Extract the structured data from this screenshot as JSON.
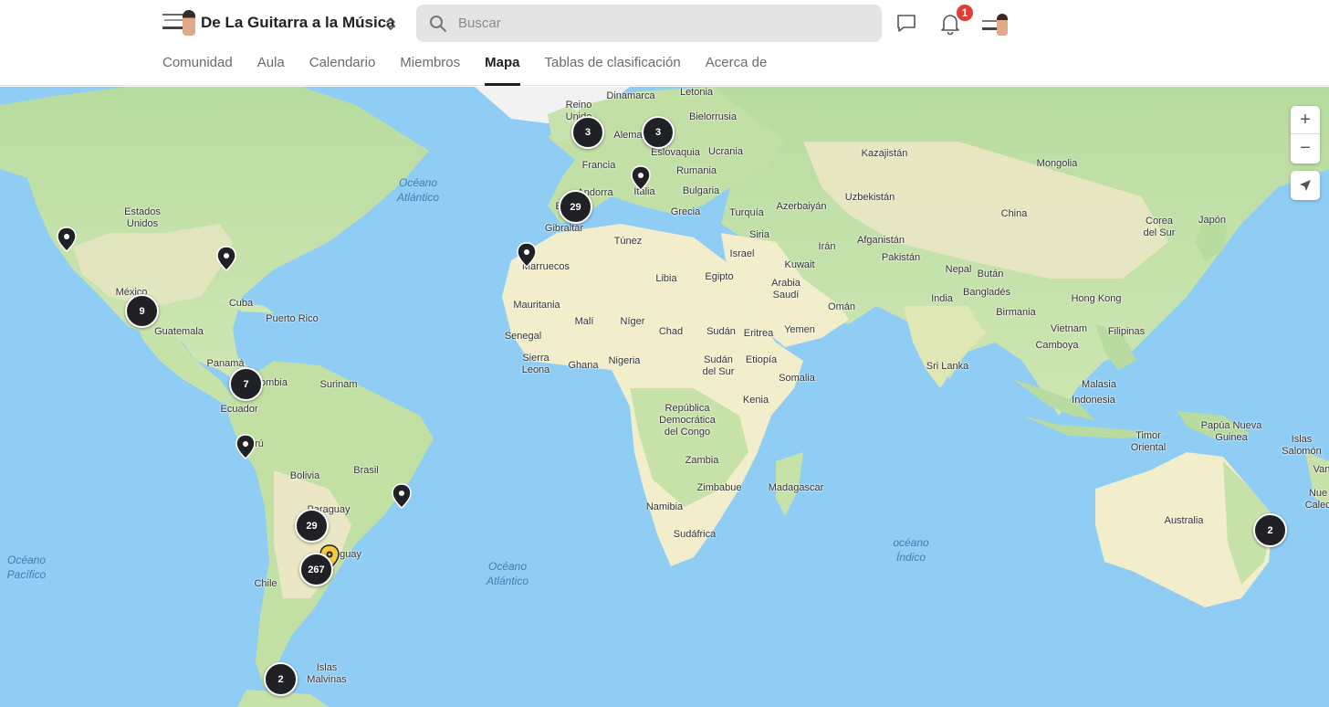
{
  "header": {
    "group_name": "De La Guitarra a la Música",
    "search_placeholder": "Buscar",
    "notification_count": "1",
    "icons": [
      "group-logo",
      "switcher-chevrons-icon",
      "search-icon",
      "chat-icon",
      "bell-icon",
      "user-avatar"
    ]
  },
  "nav": {
    "tabs": [
      {
        "label": "Comunidad",
        "active": false
      },
      {
        "label": "Aula",
        "active": false
      },
      {
        "label": "Calendario",
        "active": false
      },
      {
        "label": "Miembros",
        "active": false
      },
      {
        "label": "Mapa",
        "active": true
      },
      {
        "label": "Tablas de clasificación",
        "active": false
      },
      {
        "label": "Acerca de",
        "active": false
      }
    ]
  },
  "map": {
    "zoom_in_label": "+",
    "zoom_out_label": "−",
    "oceans": {
      "atlantico_norte": "Océano\nAtlántico",
      "atlantico_sur": "Océano\nAtlántico",
      "pacifico": "Océano\nPacífico",
      "indico": "océano\nÍndico"
    },
    "countries": {
      "estados_unidos": "Estados\nUnidos",
      "mexico": "México",
      "cuba": "Cuba",
      "puerto_rico": "Puerto Rico",
      "guatemala": "Guatemala",
      "panama": "Panamá",
      "colombia": "ombia",
      "surinam": "Surinam",
      "ecuador": "Ecuador",
      "peru": "rú",
      "brasil": "Brasil",
      "bolivia": "Bolivia",
      "paraguay": "Paraguay",
      "uruguay": "uguay",
      "chile": "Chile",
      "malvinas": "Islas\nMalvinas",
      "reino_unido": "Reino\nUnido",
      "dinamarca": "Dinamarca",
      "letonia": "Letonia",
      "bielorrusia": "Bielorrusia",
      "alemania": "Alema",
      "eslovaquia": "Eslovaquia",
      "ucrania": "Ucrania",
      "francia": "Francia",
      "rumania": "Rumania",
      "andorra": "Andorra",
      "italia": "Italia",
      "bulgaria": "Bulgaria",
      "espana": "E",
      "grecia": "Grecia",
      "turquia": "Turquía",
      "gibraltar": "Gibraltar",
      "tunez": "Túnez",
      "marruecos": "Marruecos",
      "libia": "Libia",
      "egipto": "Egipto",
      "mauritania": "Mauritania",
      "mali": "Malí",
      "niger": "Níger",
      "chad": "Chad",
      "sudan": "Sudán",
      "senegal": "Senegal",
      "sierra_leona": "Sierra\nLeona",
      "ghana": "Ghana",
      "nigeria": "Nigeria",
      "sudan_sur": "Sudán\ndel Sur",
      "etiopia": "Etiopía",
      "eritrea": "Eritrea",
      "somalia": "Somalia",
      "kenia": "Kenia",
      "rd_congo": "República\nDemocrática\ndel Congo",
      "zambia": "Zambia",
      "zimbabue": "Zimbabue",
      "namibia": "Namibia",
      "sudafrica": "Sudáfrica",
      "madagascar": "Madagascar",
      "siria": "Siria",
      "israel": "Israel",
      "kuwait": "Kuwait",
      "arabia_saudi": "Arabia\nSaudí",
      "oman": "Omán",
      "yemen": "Yemen",
      "iran": "Irán",
      "azerbaiyan": "Azerbaiyán",
      "kazajistan": "Kazajistán",
      "uzbekistan": "Uzbekistán",
      "afganistan": "Afganistán",
      "pakistan": "Pakistán",
      "india": "India",
      "nepal": "Nepal",
      "butan": "Bután",
      "bangladés": "Bangladés",
      "sri_lanka": "Sri Lanka",
      "mongolia": "Mongolia",
      "china": "China",
      "corea_sur": "Corea\ndel Sur",
      "japon": "Japón",
      "hong_kong": "Hong Kong",
      "birmania": "Birmania",
      "vietnam": "Vietnam",
      "camboya": "Camboya",
      "filipinas": "Filipinas",
      "malasia": "Malasia",
      "indonesia": "Indonesia",
      "timor_oriental": "Timor\nOriental",
      "papua": "Papúa Nueva\nGuinea",
      "islas_salomon": "Islas\nSalomón",
      "vanuatu": "Van",
      "nueva_caledonia": "Nue\nCaled",
      "australia": "Australia"
    },
    "clusters": {
      "uk": "3",
      "poland": "3",
      "spain": "29",
      "mexico": "9",
      "colombia": "7",
      "paraguay": "29",
      "argentina": "267",
      "patagonia": "2",
      "australia": "2"
    },
    "pin_color": "#202124",
    "highlight_pin_color": "#f5c842",
    "land_color": "#f2eecb",
    "water_color": "#8fcdf5",
    "green_color": "#b8dca0"
  }
}
